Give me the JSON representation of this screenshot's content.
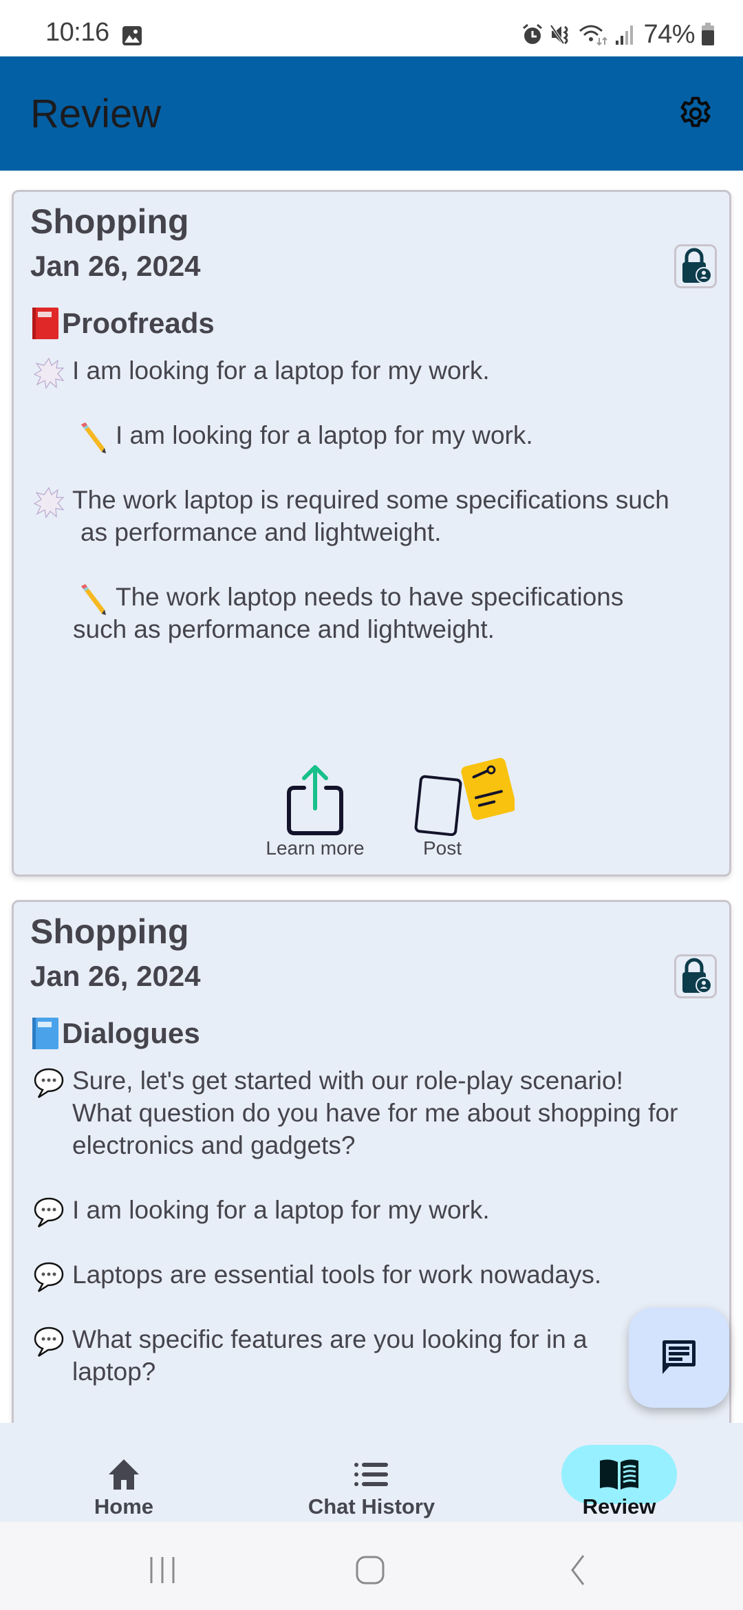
{
  "status_bar": {
    "time": "10:16",
    "battery_percent": "74%",
    "icons": [
      "gallery-notification-icon",
      "alarm-icon",
      "mute-vibrate-icon",
      "wifi-icon",
      "signal-icon",
      "battery-icon"
    ]
  },
  "app_bar": {
    "title": "Review",
    "settings_icon": "gear-icon"
  },
  "cards": [
    {
      "title": "Shopping",
      "date": "Jan 26, 2024",
      "lock_icon": "lock-person-icon",
      "section": {
        "icon": "red-book-icon",
        "label": "Proofreads"
      },
      "entries": [
        {
          "type": "original",
          "icon": "anger-burst-icon",
          "text": "I am looking for a laptop for my work."
        },
        {
          "type": "corrected",
          "icon": "pencil-icon",
          "text": "I am looking for a laptop for my work."
        },
        {
          "type": "original",
          "icon": "anger-burst-icon",
          "text": "The work laptop is required some specifications such",
          "text_cont": "as performance and lightweight."
        },
        {
          "type": "corrected",
          "icon": "pencil-icon",
          "text": "The work laptop needs to have specifications",
          "text_cont": "such as performance and lightweight."
        }
      ],
      "actions": [
        {
          "label": "Learn more",
          "icon": "share-upload-icon"
        },
        {
          "label": "Post",
          "icon": "post-note-icon"
        }
      ]
    },
    {
      "title": "Shopping",
      "date": "Jan 26, 2024",
      "lock_icon": "lock-person-icon",
      "section": {
        "icon": "blue-book-icon",
        "label": "Dialogues"
      },
      "entries": [
        {
          "icon": "speech-bubble-icon",
          "lines": [
            "Sure, let's get started with our role-play scenario!",
            "What question do you have for me about shopping for",
            "electronics and gadgets?"
          ]
        },
        {
          "icon": "speech-bubble-icon",
          "lines": [
            "I am looking for a laptop for my work."
          ]
        },
        {
          "icon": "speech-bubble-icon",
          "lines": [
            "Laptops are essential tools for work nowadays."
          ]
        },
        {
          "icon": "speech-bubble-icon",
          "lines": [
            "What specific features are you looking for in a",
            "laptop?"
          ]
        }
      ]
    }
  ],
  "fab": {
    "icon": "chat-message-icon"
  },
  "bottom_nav": {
    "items": [
      {
        "label": "Home",
        "icon": "home-icon",
        "active": false
      },
      {
        "label": "Chat History",
        "icon": "list-icon",
        "active": false
      },
      {
        "label": "Review",
        "icon": "open-book-icon",
        "active": true
      }
    ]
  },
  "system_nav": [
    "recents-button",
    "home-button",
    "back-button"
  ],
  "colors": {
    "app_bar": "#0460a4",
    "card_bg": "#e8eef7",
    "active_nav_pill": "#97f0ff",
    "fab_bg": "#d3e3fd",
    "text": "#45444c"
  }
}
